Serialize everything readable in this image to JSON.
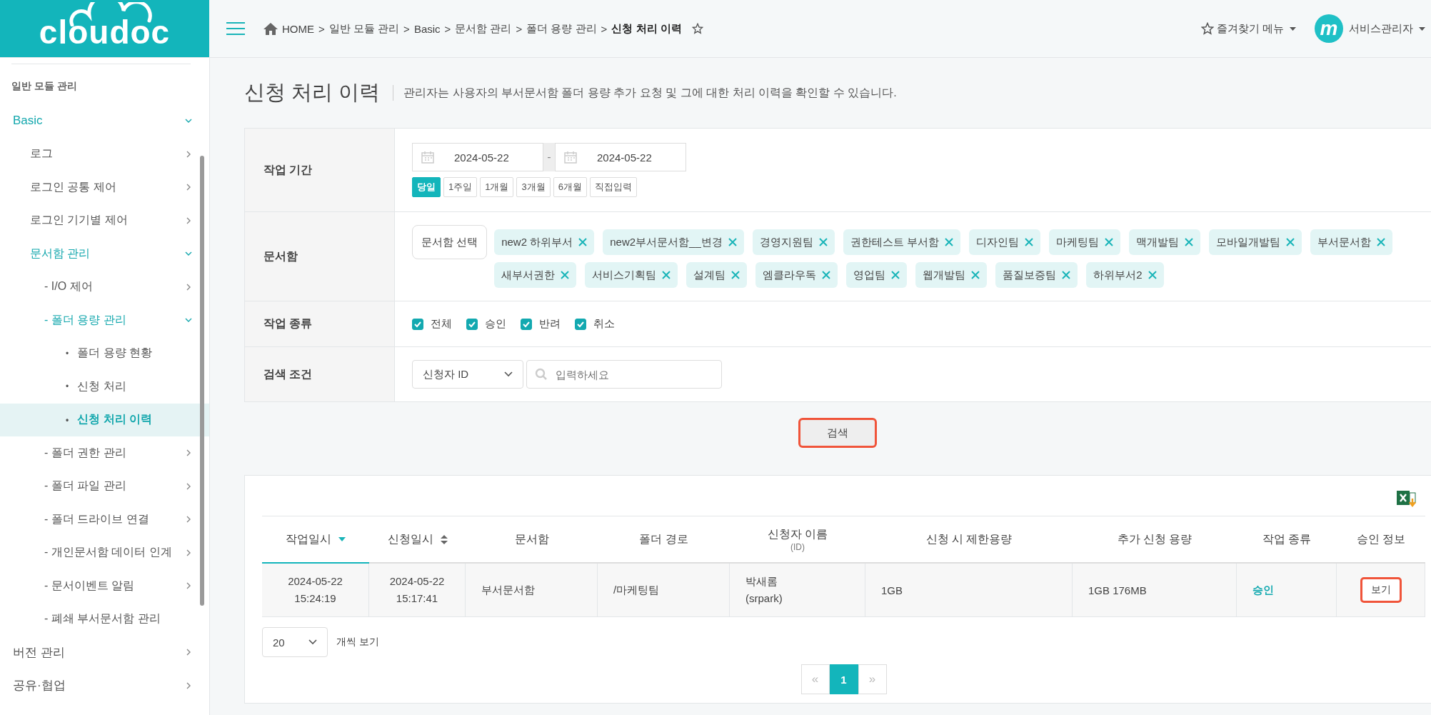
{
  "logo": "cloudoc",
  "header": {
    "breadcrumb": [
      "HOME",
      "일반 모듈 관리",
      "Basic",
      "문서함 관리",
      "폴더 용량 관리"
    ],
    "breadcrumb_separator": ">",
    "current": "신청 처리 이력",
    "favorite_menu": "즐겨찾기 메뉴",
    "avatar_letter": "m",
    "user": "서비스관리자"
  },
  "sidebar": {
    "heading": "일반 모듈 관리",
    "items": [
      {
        "label": "Basic",
        "expanded": true,
        "selected": false,
        "children": [
          {
            "label": "로그",
            "expanded": false,
            "selected": false
          },
          {
            "label": "로그인 공통 제어",
            "expanded": false,
            "selected": false
          },
          {
            "label": "로그인 기기별 제어",
            "expanded": false,
            "selected": false
          },
          {
            "label": "문서함 관리",
            "expanded": true,
            "selected": false,
            "children": [
              {
                "label": "- I/O 제어",
                "expanded": false,
                "selected": false
              },
              {
                "label": "- 폴더 용량 관리",
                "expanded": true,
                "selected": false,
                "children": [
                  {
                    "label": "폴더 용량 현황",
                    "bullet": "•",
                    "selected": false
                  },
                  {
                    "label": "신청 처리",
                    "bullet": "•",
                    "selected": false
                  },
                  {
                    "label": "신청 처리 이력",
                    "bullet": "•",
                    "selected": true
                  }
                ]
              },
              {
                "label": "- 폴더 권한 관리",
                "expanded": false,
                "selected": false
              },
              {
                "label": "- 폴더 파일 관리",
                "expanded": false,
                "selected": false
              },
              {
                "label": "- 폴더 드라이브 연결",
                "expanded": false,
                "selected": false
              },
              {
                "label": "- 개인문서함 데이터 인계",
                "expanded": false,
                "selected": false
              },
              {
                "label": "- 문서이벤트 알림",
                "expanded": false,
                "selected": false
              },
              {
                "label": "- 폐쇄 부서문서함 관리",
                "selected": false
              }
            ]
          }
        ]
      },
      {
        "label": "버전 관리",
        "expanded": false,
        "selected": false
      },
      {
        "label": "공유·협업",
        "expanded": false,
        "selected": false
      }
    ]
  },
  "page": {
    "title": "신청 처리 이력",
    "description": "관리자는 사용자의 부서문서함 폴더 용량 추가 요청 및 그에 대한 처리 이력을 확인할 수 있습니다."
  },
  "filters": {
    "period": {
      "label": "작업 기간",
      "from": "2024-05-22",
      "separator": "-",
      "to": "2024-05-22",
      "ranges": [
        {
          "label": "당일",
          "selected": true
        },
        {
          "label": "1주일",
          "selected": false
        },
        {
          "label": "1개월",
          "selected": false
        },
        {
          "label": "3개월",
          "selected": false
        },
        {
          "label": "6개월",
          "selected": false
        },
        {
          "label": "직접입력",
          "selected": false
        }
      ]
    },
    "box": {
      "label": "문서함",
      "select_button": "문서함 선택",
      "chips": [
        "new2 하위부서",
        "new2부서문서함__변경",
        "경영지원팀",
        "권한테스트 부서함",
        "디자인팀",
        "마케팅팀",
        "맥개발팀",
        "모바일개발팀",
        "부서문서함",
        "새부서권한",
        "서비스기획팀",
        "설계팀",
        "엠클라우독",
        "영업팀",
        "웹개발팀",
        "품질보증팀",
        "하위부서2"
      ]
    },
    "types": {
      "label": "작업 종류",
      "options": [
        {
          "label": "전체",
          "checked": true
        },
        {
          "label": "승인",
          "checked": true
        },
        {
          "label": "반려",
          "checked": true
        },
        {
          "label": "취소",
          "checked": true
        }
      ]
    },
    "condition": {
      "label": "검색 조건",
      "field": "신청자 ID",
      "placeholder": "입력하세요"
    }
  },
  "search_button": {
    "label": "검색",
    "highlighted": true
  },
  "table": {
    "columns": [
      {
        "label": "작업일시",
        "sortable": true,
        "selected": true
      },
      {
        "label": "신청일시",
        "sortable": true,
        "selected": false
      },
      {
        "label": "문서함",
        "sortable": false,
        "selected": false
      },
      {
        "label": "폴더 경로",
        "sortable": false,
        "selected": false
      },
      {
        "label": "신청자 이름",
        "sub": "(ID)",
        "sortable": false,
        "selected": false
      },
      {
        "label": "신청 시 제한용량",
        "sortable": false,
        "selected": false
      },
      {
        "label": "추가 신청 용량",
        "sortable": false,
        "selected": false
      },
      {
        "label": "작업 종류",
        "sortable": false,
        "selected": false
      },
      {
        "label": "승인 정보",
        "sortable": false,
        "selected": false
      }
    ],
    "rows": [
      [
        {
          "kind": "lines",
          "lines": [
            "2024-05-22",
            "15:24:19"
          ]
        },
        {
          "kind": "lines",
          "lines": [
            "2024-05-22",
            "15:17:41"
          ]
        },
        {
          "kind": "text",
          "text": "부서문서함"
        },
        {
          "kind": "text",
          "text": "/마케팅팀"
        },
        {
          "kind": "lines",
          "lines": [
            "박새롬",
            "(srpark)"
          ]
        },
        {
          "kind": "text",
          "text": "1GB"
        },
        {
          "kind": "text",
          "text": "1GB 176MB"
        },
        {
          "kind": "status",
          "text": "승인"
        },
        {
          "kind": "button",
          "text": "보기",
          "highlighted": true
        }
      ]
    ]
  },
  "page_size": {
    "value": "20",
    "suffix": "개씩 보기"
  },
  "pagination": [
    {
      "label": "«",
      "kind": "arrow",
      "selected": false
    },
    {
      "label": "1",
      "kind": "page",
      "selected": true
    },
    {
      "label": "»",
      "kind": "arrow",
      "selected": false
    }
  ]
}
